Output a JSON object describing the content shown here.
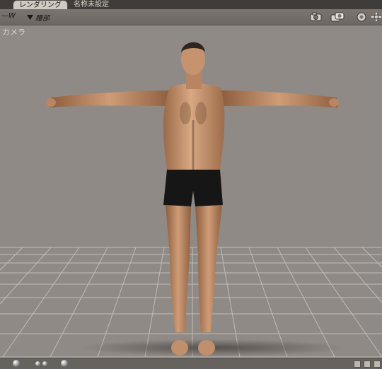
{
  "tabs": {
    "active": "レンダリング",
    "inactive": "名称未設定"
  },
  "toolbar": {
    "mode": "—W",
    "part_selector": "腰部"
  },
  "viewport": {
    "camera_label": "カメラ"
  },
  "icons": {
    "camera": "camera-icon",
    "gear": "gear-icon",
    "move": "move-icon",
    "dropdown": "triangle-down-icon"
  }
}
